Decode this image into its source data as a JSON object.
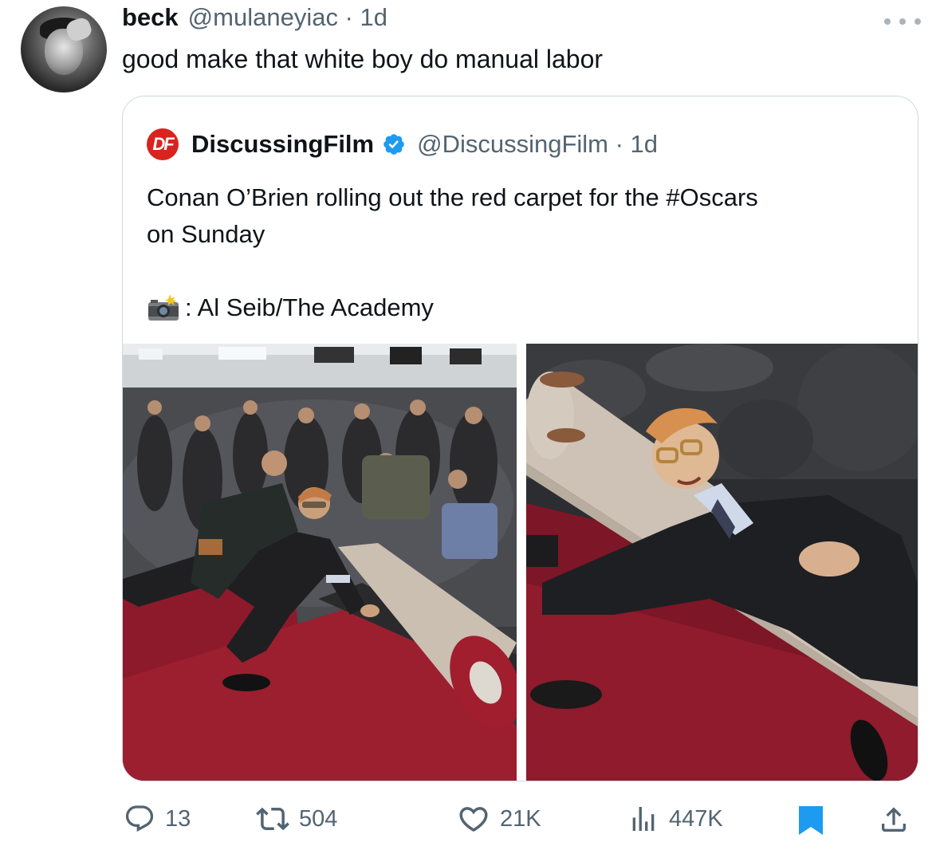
{
  "tweet": {
    "author_name": "beck",
    "author_handle": "@mulaneyiac · 1d",
    "text": "good make that white boy do manual labor"
  },
  "quoted_tweet": {
    "author_name": "DiscussingFilm",
    "author_handle": "@DiscussingFilm · 1d",
    "text_line1": "Conan O’Brien rolling out the red carpet for the #Oscars",
    "text_line2": "on Sunday",
    "photo_credit": ": Al Seib/The Academy",
    "logo_text": "DF",
    "brand_color": "#d9231f",
    "verified_color": "#1d9bf0"
  },
  "actions": {
    "replies": "13",
    "retweets": "504",
    "likes": "21K",
    "views": "447K"
  },
  "colors": {
    "text_primary": "#0f1419",
    "text_secondary": "#536471",
    "bookmark_active": "#1d9bf0"
  }
}
